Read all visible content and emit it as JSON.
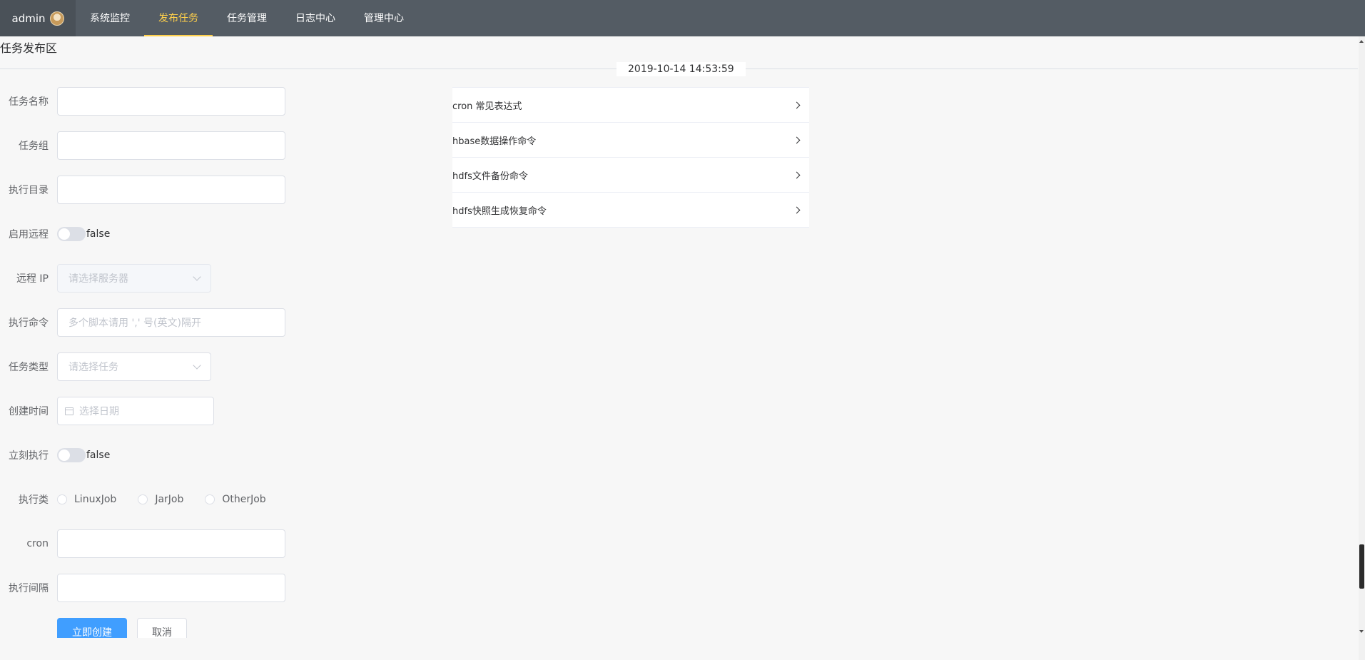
{
  "nav": {
    "user": "admin",
    "items": [
      "系统监控",
      "发布任务",
      "任务管理",
      "日志中心",
      "管理中心"
    ],
    "active_index": 1,
    "accent_color": "#ffd04b",
    "background_color": "#545c64"
  },
  "section": {
    "title": "任务发布区",
    "timestamp": "2019-10-14 14:53:59"
  },
  "form": {
    "task_name": {
      "label": "任务名称",
      "value": ""
    },
    "task_group": {
      "label": "任务组",
      "value": ""
    },
    "exec_dir": {
      "label": "执行目录",
      "value": ""
    },
    "enable_remote": {
      "label": "启用远程",
      "state": "false"
    },
    "remote_ip": {
      "label": "远程 IP",
      "placeholder": "请选择服务器"
    },
    "exec_command": {
      "label": "执行命令",
      "placeholder": "多个脚本请用 ',' 号(英文)隔开"
    },
    "task_type": {
      "label": "任务类型",
      "placeholder": "请选择任务"
    },
    "create_time": {
      "label": "创建时间",
      "placeholder": "选择日期"
    },
    "execute_now": {
      "label": "立刻执行",
      "state": "false"
    },
    "exec_class": {
      "label": "执行类",
      "options": [
        "LinuxJob",
        "JarJob",
        "OtherJob"
      ]
    },
    "cron": {
      "label": "cron",
      "value": ""
    },
    "exec_interval": {
      "label": "执行间隔",
      "value": ""
    },
    "submit_label": "立即创建",
    "cancel_label": "取消"
  },
  "collapse": {
    "items": [
      "cron 常见表达式",
      "hbase数据操作命令",
      "hdfs文件备份命令",
      "hdfs快照生成恢复命令"
    ]
  },
  "colors": {
    "primary": "#409eff"
  }
}
